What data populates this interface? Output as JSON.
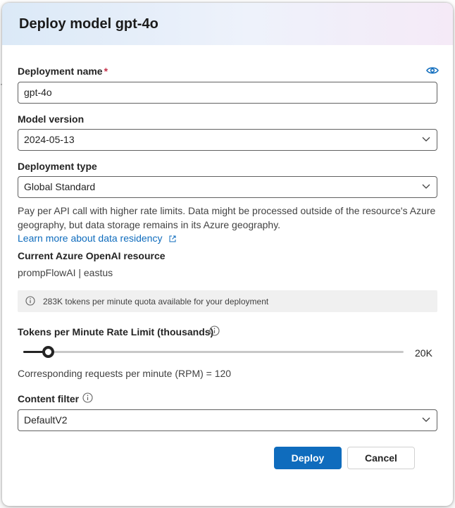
{
  "dialog": {
    "title": "Deploy model gpt-4o"
  },
  "deployment_name": {
    "label": "Deployment name",
    "required_marker": "*",
    "value": "gpt-4o",
    "visibility_icon": "eye-icon"
  },
  "model_version": {
    "label": "Model version",
    "selected": "2024-05-13"
  },
  "deployment_type": {
    "label": "Deployment type",
    "selected": "Global Standard",
    "description": "Pay per API call with higher rate limits. Data might be processed outside of the resource's Azure geography, but data storage remains in its Azure geography.",
    "link_text": "Learn more about data residency"
  },
  "resource": {
    "label": "Current Azure OpenAI resource",
    "value": "prompFlowAI | eastus"
  },
  "quota": {
    "message": "283K tokens per minute quota available for your deployment"
  },
  "rate_limit": {
    "label": "Tokens per Minute Rate Limit (thousands)",
    "value_label": "20K",
    "slider_fraction": 0.066,
    "rpm_text": "Corresponding requests per minute (RPM) = 120"
  },
  "content_filter": {
    "label": "Content filter",
    "selected": "DefaultV2"
  },
  "buttons": {
    "deploy": "Deploy",
    "cancel": "Cancel"
  },
  "colors": {
    "accent": "#0f6cbd",
    "required": "#c4314b"
  }
}
